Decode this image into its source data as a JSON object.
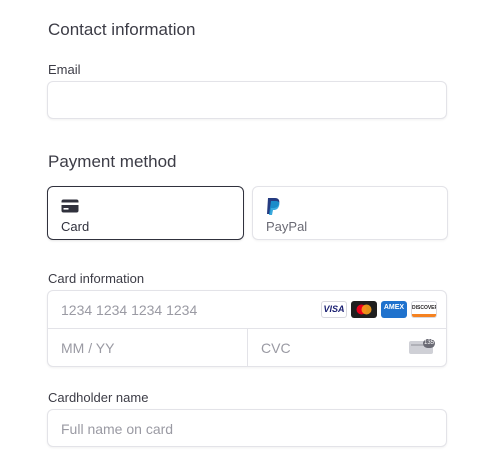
{
  "contact": {
    "heading": "Contact information",
    "email_label": "Email",
    "email_value": ""
  },
  "payment": {
    "heading": "Payment method",
    "methods": [
      {
        "label": "Card",
        "icon": "card-icon",
        "selected": true
      },
      {
        "label": "PayPal",
        "icon": "paypal-icon",
        "selected": false
      }
    ]
  },
  "card_info": {
    "label": "Card information",
    "number_placeholder": "1234 1234 1234 1234",
    "expiry_placeholder": "MM / YY",
    "cvc_placeholder": "CVC",
    "brands": [
      "VISA",
      "mastercard",
      "AMEX",
      "DISCOVER"
    ],
    "cvc_badge": "135"
  },
  "cardholder": {
    "label": "Cardholder name",
    "placeholder": "Full name on card"
  },
  "colors": {
    "selected_border": "#30313d",
    "border": "#e3e3e8",
    "placeholder": "#9a9aa3",
    "paypal_dark": "#253b80",
    "paypal_light": "#179bd7"
  }
}
